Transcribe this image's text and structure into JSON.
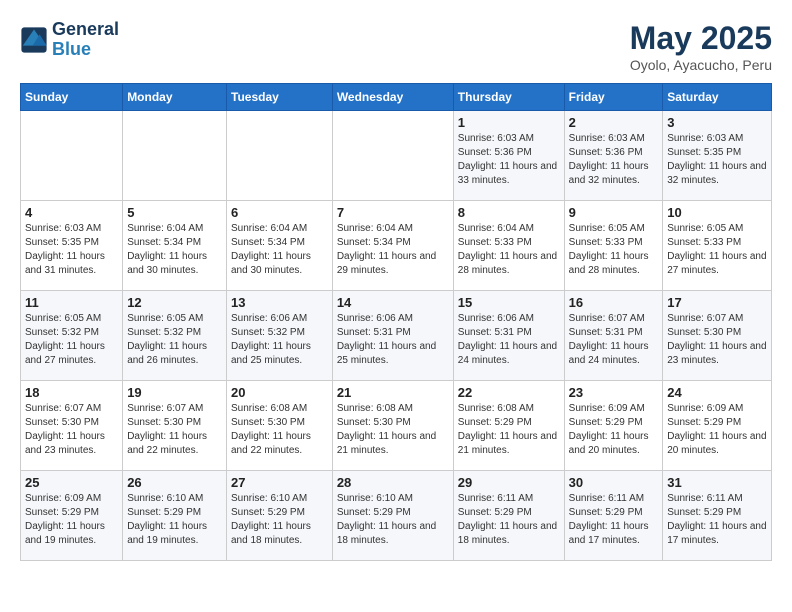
{
  "header": {
    "logo_line1": "General",
    "logo_line2": "Blue",
    "title": "May 2025",
    "subtitle": "Oyolo, Ayacucho, Peru"
  },
  "columns": [
    "Sunday",
    "Monday",
    "Tuesday",
    "Wednesday",
    "Thursday",
    "Friday",
    "Saturday"
  ],
  "weeks": [
    [
      {
        "day": "",
        "info": ""
      },
      {
        "day": "",
        "info": ""
      },
      {
        "day": "",
        "info": ""
      },
      {
        "day": "",
        "info": ""
      },
      {
        "day": "1",
        "info": "Sunrise: 6:03 AM\nSunset: 5:36 PM\nDaylight: 11 hours\nand 33 minutes."
      },
      {
        "day": "2",
        "info": "Sunrise: 6:03 AM\nSunset: 5:36 PM\nDaylight: 11 hours\nand 32 minutes."
      },
      {
        "day": "3",
        "info": "Sunrise: 6:03 AM\nSunset: 5:35 PM\nDaylight: 11 hours\nand 32 minutes."
      }
    ],
    [
      {
        "day": "4",
        "info": "Sunrise: 6:03 AM\nSunset: 5:35 PM\nDaylight: 11 hours\nand 31 minutes."
      },
      {
        "day": "5",
        "info": "Sunrise: 6:04 AM\nSunset: 5:34 PM\nDaylight: 11 hours\nand 30 minutes."
      },
      {
        "day": "6",
        "info": "Sunrise: 6:04 AM\nSunset: 5:34 PM\nDaylight: 11 hours\nand 30 minutes."
      },
      {
        "day": "7",
        "info": "Sunrise: 6:04 AM\nSunset: 5:34 PM\nDaylight: 11 hours\nand 29 minutes."
      },
      {
        "day": "8",
        "info": "Sunrise: 6:04 AM\nSunset: 5:33 PM\nDaylight: 11 hours\nand 28 minutes."
      },
      {
        "day": "9",
        "info": "Sunrise: 6:05 AM\nSunset: 5:33 PM\nDaylight: 11 hours\nand 28 minutes."
      },
      {
        "day": "10",
        "info": "Sunrise: 6:05 AM\nSunset: 5:33 PM\nDaylight: 11 hours\nand 27 minutes."
      }
    ],
    [
      {
        "day": "11",
        "info": "Sunrise: 6:05 AM\nSunset: 5:32 PM\nDaylight: 11 hours\nand 27 minutes."
      },
      {
        "day": "12",
        "info": "Sunrise: 6:05 AM\nSunset: 5:32 PM\nDaylight: 11 hours\nand 26 minutes."
      },
      {
        "day": "13",
        "info": "Sunrise: 6:06 AM\nSunset: 5:32 PM\nDaylight: 11 hours\nand 25 minutes."
      },
      {
        "day": "14",
        "info": "Sunrise: 6:06 AM\nSunset: 5:31 PM\nDaylight: 11 hours\nand 25 minutes."
      },
      {
        "day": "15",
        "info": "Sunrise: 6:06 AM\nSunset: 5:31 PM\nDaylight: 11 hours\nand 24 minutes."
      },
      {
        "day": "16",
        "info": "Sunrise: 6:07 AM\nSunset: 5:31 PM\nDaylight: 11 hours\nand 24 minutes."
      },
      {
        "day": "17",
        "info": "Sunrise: 6:07 AM\nSunset: 5:30 PM\nDaylight: 11 hours\nand 23 minutes."
      }
    ],
    [
      {
        "day": "18",
        "info": "Sunrise: 6:07 AM\nSunset: 5:30 PM\nDaylight: 11 hours\nand 23 minutes."
      },
      {
        "day": "19",
        "info": "Sunrise: 6:07 AM\nSunset: 5:30 PM\nDaylight: 11 hours\nand 22 minutes."
      },
      {
        "day": "20",
        "info": "Sunrise: 6:08 AM\nSunset: 5:30 PM\nDaylight: 11 hours\nand 22 minutes."
      },
      {
        "day": "21",
        "info": "Sunrise: 6:08 AM\nSunset: 5:30 PM\nDaylight: 11 hours\nand 21 minutes."
      },
      {
        "day": "22",
        "info": "Sunrise: 6:08 AM\nSunset: 5:29 PM\nDaylight: 11 hours\nand 21 minutes."
      },
      {
        "day": "23",
        "info": "Sunrise: 6:09 AM\nSunset: 5:29 PM\nDaylight: 11 hours\nand 20 minutes."
      },
      {
        "day": "24",
        "info": "Sunrise: 6:09 AM\nSunset: 5:29 PM\nDaylight: 11 hours\nand 20 minutes."
      }
    ],
    [
      {
        "day": "25",
        "info": "Sunrise: 6:09 AM\nSunset: 5:29 PM\nDaylight: 11 hours\nand 19 minutes."
      },
      {
        "day": "26",
        "info": "Sunrise: 6:10 AM\nSunset: 5:29 PM\nDaylight: 11 hours\nand 19 minutes."
      },
      {
        "day": "27",
        "info": "Sunrise: 6:10 AM\nSunset: 5:29 PM\nDaylight: 11 hours\nand 18 minutes."
      },
      {
        "day": "28",
        "info": "Sunrise: 6:10 AM\nSunset: 5:29 PM\nDaylight: 11 hours\nand 18 minutes."
      },
      {
        "day": "29",
        "info": "Sunrise: 6:11 AM\nSunset: 5:29 PM\nDaylight: 11 hours\nand 18 minutes."
      },
      {
        "day": "30",
        "info": "Sunrise: 6:11 AM\nSunset: 5:29 PM\nDaylight: 11 hours\nand 17 minutes."
      },
      {
        "day": "31",
        "info": "Sunrise: 6:11 AM\nSunset: 5:29 PM\nDaylight: 11 hours\nand 17 minutes."
      }
    ]
  ]
}
